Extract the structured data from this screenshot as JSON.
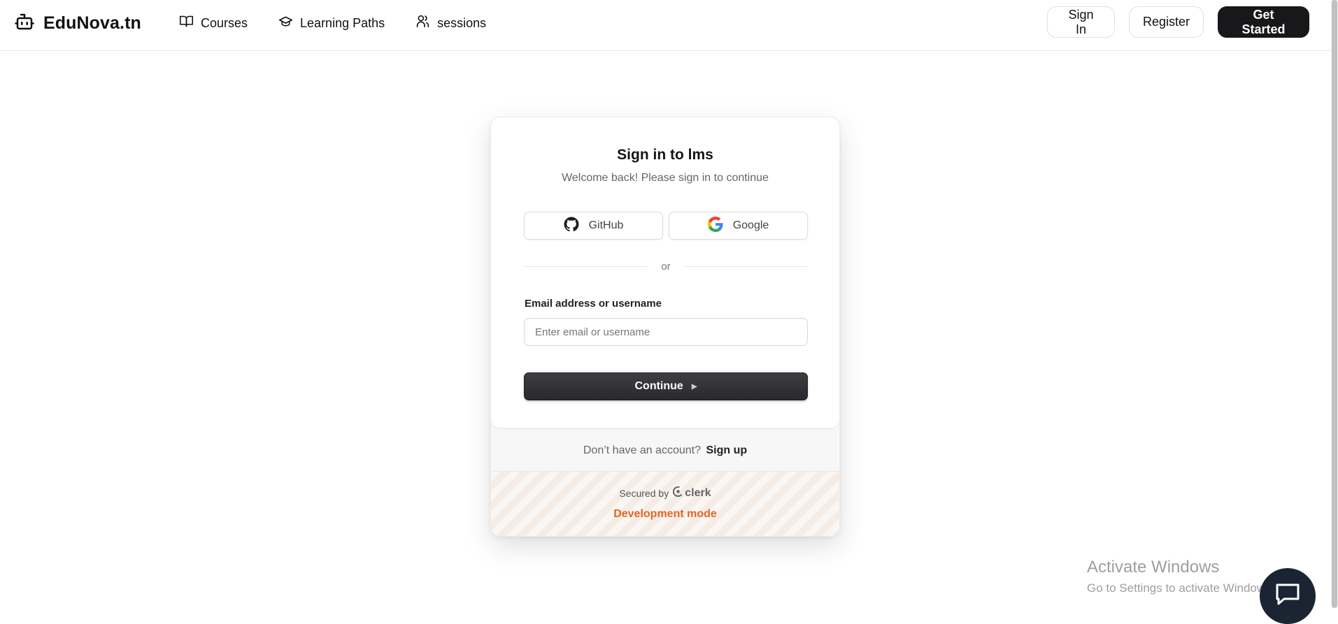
{
  "header": {
    "brand": "EduNova.tn",
    "brand_icon": "robot-icon",
    "nav": [
      {
        "label": "Courses",
        "icon": "book-icon"
      },
      {
        "label": "Learning Paths",
        "icon": "graduation-cap-icon"
      },
      {
        "label": "sessions",
        "icon": "users-icon"
      }
    ],
    "actions": {
      "sign_in": "Sign In",
      "register": "Register",
      "get_started": "Get Started"
    }
  },
  "signin": {
    "title": "Sign in to lms",
    "subtitle": "Welcome back! Please sign in to continue",
    "social": {
      "github": "GitHub",
      "google": "Google"
    },
    "divider": "or",
    "email_label": "Email address or username",
    "email_placeholder": "Enter email or username",
    "email_value": "",
    "continue": "Continue",
    "no_account": "Don’t have an account?",
    "sign_up": "Sign up",
    "secured_by": "Secured by",
    "provider": "clerk",
    "dev_mode": "Development mode"
  },
  "watermark": {
    "title": "Activate Windows",
    "subtitle": "Go to Settings to activate Windows."
  },
  "colors": {
    "primary_dark": "#18181b",
    "dev_mode_orange": "#e2661f",
    "chat_fab": "#1a2433"
  }
}
